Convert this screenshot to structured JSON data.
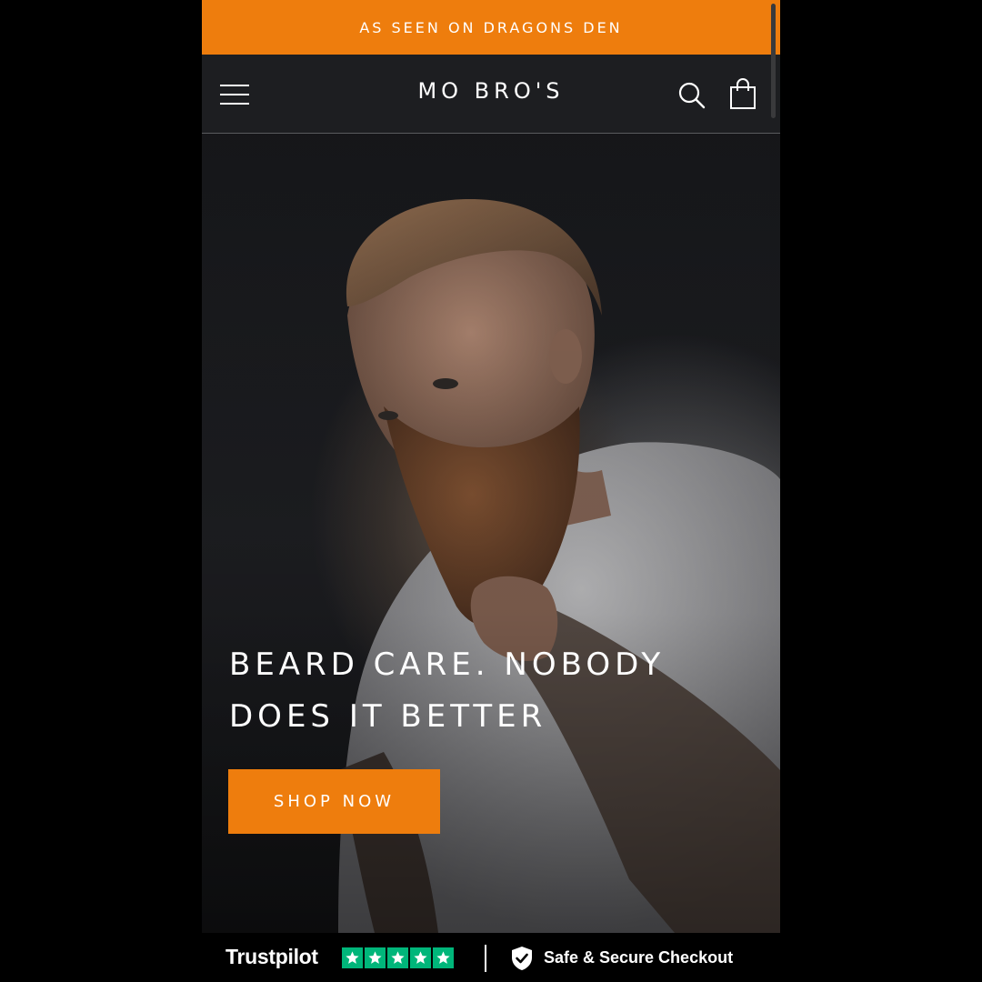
{
  "announcement": {
    "text": "AS SEEN ON DRAGONS DEN"
  },
  "header": {
    "brand": "MO BRO'S",
    "menu_icon": "hamburger-menu-icon",
    "search_icon": "search-icon",
    "cart_icon": "shopping-bag-icon"
  },
  "hero": {
    "image": "bearded-man-portrait",
    "headline_line1": "BEARD CARE. NOBODY",
    "headline_line2": "DOES IT BETTER",
    "cta_label": "SHOP NOW"
  },
  "trust_bar": {
    "trustpilot_label": "Trustpilot",
    "rating_stars": 5,
    "rating_max": 5,
    "secure_label": "Safe & Secure Checkout",
    "shield_icon": "shield-check-icon"
  },
  "colors": {
    "accent": "#ee7d0d",
    "header_bg": "#1d1e21",
    "trustpilot_green": "#00b67a",
    "page_bg": "#000000"
  }
}
